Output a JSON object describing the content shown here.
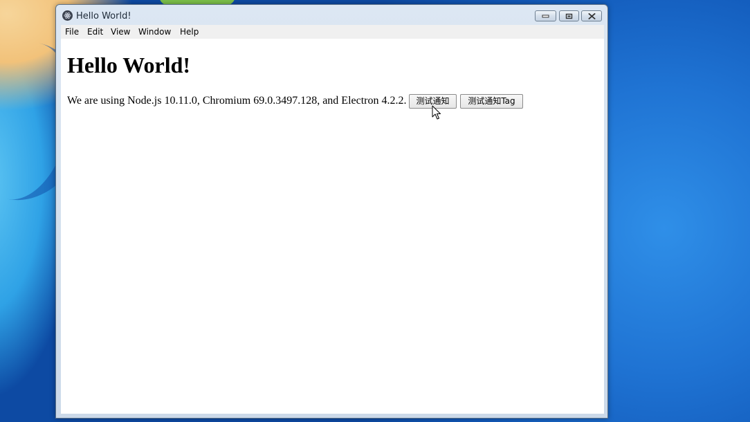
{
  "window": {
    "title": "Hello World!",
    "app_icon": "electron-icon",
    "controls": {
      "minimize": "minimize-icon",
      "maximize": "maximize-icon",
      "close": "close-icon"
    }
  },
  "menu": {
    "items": [
      {
        "label": "File"
      },
      {
        "label": "Edit"
      },
      {
        "label": "View"
      },
      {
        "label": "Window"
      },
      {
        "label": "Help"
      }
    ]
  },
  "page": {
    "heading": "Hello World!",
    "info": "We are using Node.js 10.11.0, Chromium 69.0.3497.128, and Electron 4.2.2.",
    "buttons": [
      {
        "label": "测试通知"
      },
      {
        "label": "测试通知Tag"
      }
    ]
  },
  "colors": {
    "desktop_accent": "#1d6fd0",
    "window_frame": "#cbd9e9"
  }
}
